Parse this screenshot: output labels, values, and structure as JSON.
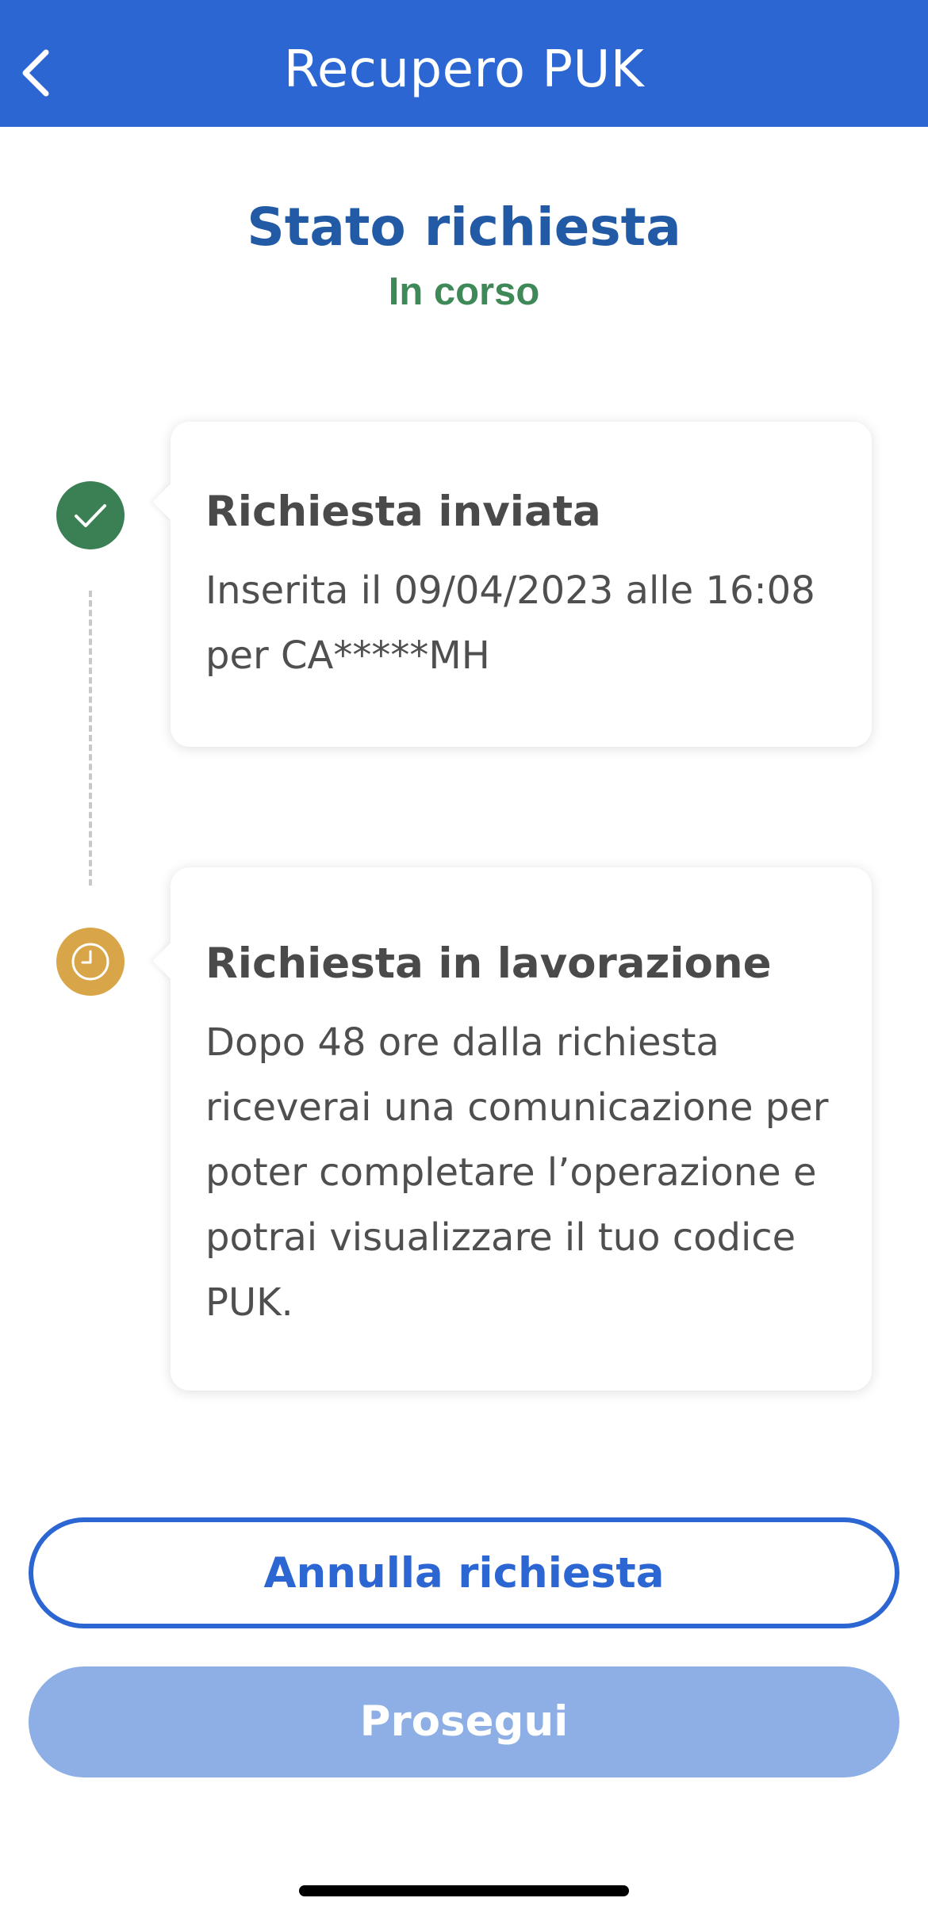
{
  "header": {
    "title": "Recupero PUK",
    "back_icon": "chevron-left-icon",
    "background_color": "#2c66d2"
  },
  "status": {
    "title": "Stato richiesta",
    "value": "In corso",
    "title_color": "#235aa6",
    "value_color": "#3f8858"
  },
  "timeline": {
    "steps": [
      {
        "icon": "check-icon",
        "state": "completed",
        "color": "#3b7f55",
        "title": "Richiesta inviata",
        "text": "Inserita il 09/04/2023 alle 16:08 per CA*****MH"
      },
      {
        "icon": "clock-icon",
        "state": "pending",
        "color": "#d8a548",
        "title": "Richiesta in lavorazione",
        "text": "Dopo 48 ore dalla richiesta riceverai una comunicazione per poter completare l’operazione e potrai visualizzare il tuo codice PUK."
      }
    ]
  },
  "actions": {
    "cancel_label": "Annulla richiesta",
    "continue_label": "Prosegui",
    "continue_disabled": true,
    "primary_color": "#2c66d2",
    "disabled_color": "#8eafe5"
  }
}
